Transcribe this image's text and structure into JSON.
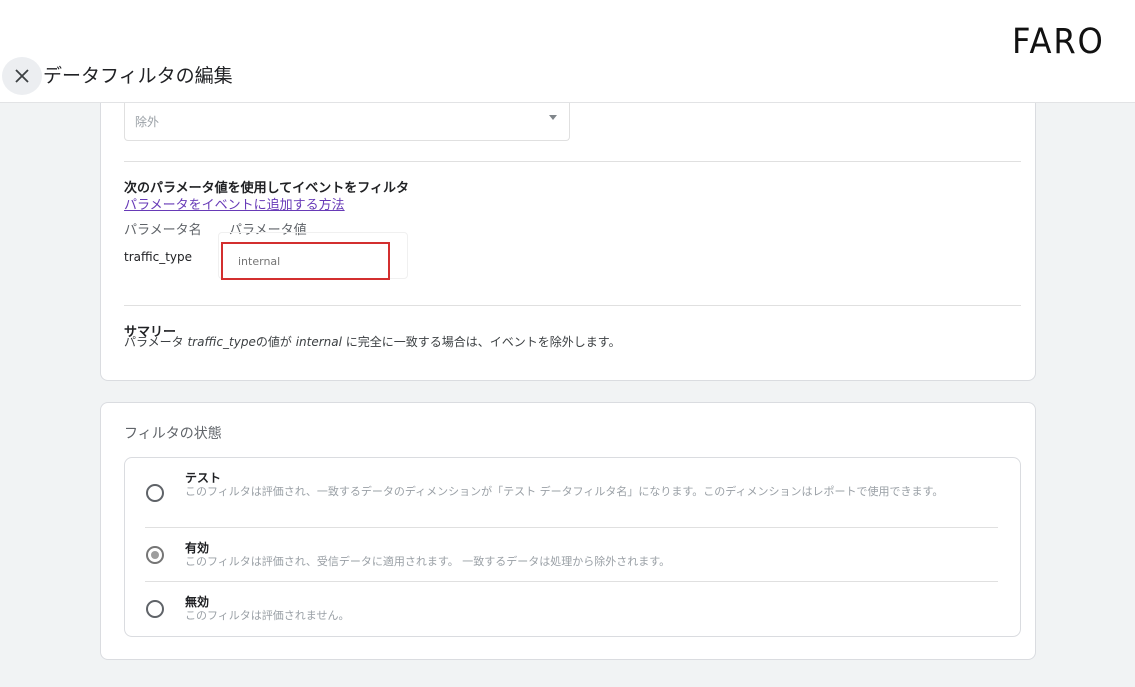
{
  "brand": {
    "logo_text": "FARO"
  },
  "header": {
    "title": "データフィルタの編集",
    "close_icon": "close-icon"
  },
  "filter_operation": {
    "selected_value": "除外"
  },
  "param_section": {
    "title": "次のパラメータ値を使用してイベントをフィルタ",
    "help_link": "パラメータをイベントに追加する方法",
    "col_name_header": "パラメータ名",
    "col_value_header": "パラメータ値",
    "param_name": "traffic_type",
    "param_value": "internal"
  },
  "summary": {
    "title": "サマリー",
    "prefix": "パラメータ",
    "param": "traffic_type",
    "mid": "の値が",
    "value": "internal",
    "suffix": "に完全に一致する場合は、イベントを除外します。"
  },
  "filter_state": {
    "title": "フィルタの状態",
    "options": [
      {
        "label": "テスト",
        "description": "このフィルタは評価され、一致するデータのディメンションが「テスト データフィルタ名」になります。このディメンションはレポートで使用できます。",
        "selected": false
      },
      {
        "label": "有効",
        "description": "このフィルタは評価され、受信データに適用されます。 一致するデータは処理から除外されます。",
        "selected": true
      },
      {
        "label": "無効",
        "description": "このフィルタは評価されません。",
        "selected": false
      }
    ]
  }
}
